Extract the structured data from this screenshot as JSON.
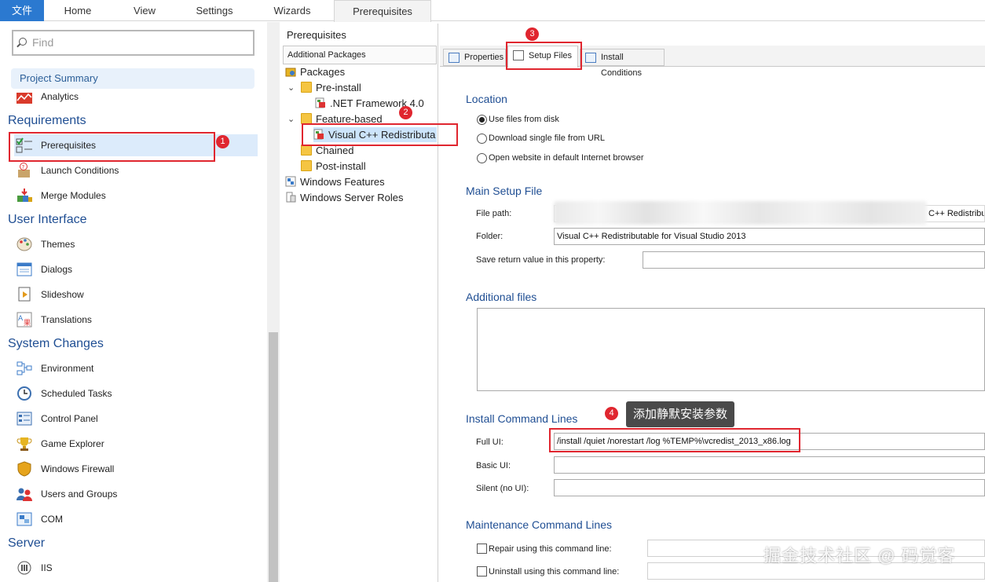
{
  "ribbon": {
    "tabs": [
      "文件",
      "Home",
      "View",
      "Settings",
      "Wizards",
      "Prerequisites"
    ],
    "active": "Prerequisites"
  },
  "nav": {
    "find_placeholder": "Find",
    "project_summary": "Project Summary",
    "analytics": "Analytics",
    "sections": {
      "requirements": "Requirements",
      "user_interface": "User Interface",
      "system_changes": "System Changes",
      "server": "Server"
    },
    "requirements_items": [
      "Prerequisites",
      "Launch Conditions",
      "Merge Modules"
    ],
    "ui_items": [
      "Themes",
      "Dialogs",
      "Slideshow",
      "Translations"
    ],
    "system_items": [
      "Environment",
      "Scheduled Tasks",
      "Control Panel",
      "Game Explorer",
      "Windows Firewall",
      "Users and Groups",
      "COM"
    ],
    "server_items": [
      "IIS"
    ]
  },
  "packages": {
    "title": "Prerequisites",
    "header": "Additional Packages",
    "root": "Packages",
    "pre_install": "Pre-install",
    "net_framework": ".NET Framework 4.0",
    "feature_based": "Feature-based",
    "vcpp": "Visual C++ Redistributa",
    "chained": "Chained",
    "post_install": "Post-install",
    "windows_features": "Windows Features",
    "windows_server_roles": "Windows Server Roles"
  },
  "main_tabs": [
    "Properties",
    "Setup Files",
    "Install Conditions"
  ],
  "location": {
    "title": "Location",
    "options": [
      "Use files from disk",
      "Download single file from URL",
      "Open website in default Internet browser"
    ],
    "selected": 0
  },
  "main_setup": {
    "title": "Main Setup File",
    "file_path_label": "File path:",
    "file_path_value": "C++ Redistribu",
    "folder_label": "Folder:",
    "folder_value": "Visual C++ Redistributable for Visual Studio 2013",
    "save_label": "Save return value in this property:",
    "save_value": ""
  },
  "additional_files": {
    "title": "Additional files"
  },
  "install_cmd": {
    "title": "Install Command Lines",
    "full_label": "Full UI:",
    "full_value": "/install /quiet /norestart /log %TEMP%\\vcredist_2013_x86.log",
    "basic_label": "Basic UI:",
    "basic_value": "",
    "silent_label": "Silent (no UI):",
    "silent_value": ""
  },
  "maint_cmd": {
    "title": "Maintenance Command Lines",
    "repair": "Repair using this command line:",
    "uninstall": "Uninstall using this command line:"
  },
  "annotations": {
    "b1": "1",
    "b2": "2",
    "b3": "3",
    "b4": "4",
    "callout": "添加静默安装参数",
    "watermark": "掘金技术社区 @ 码觉客"
  },
  "colors": {
    "accent": "#2b79d0",
    "section_heading": "#1f4e93",
    "highlight_red": "#e0262f",
    "selection": "#dcebfb"
  }
}
